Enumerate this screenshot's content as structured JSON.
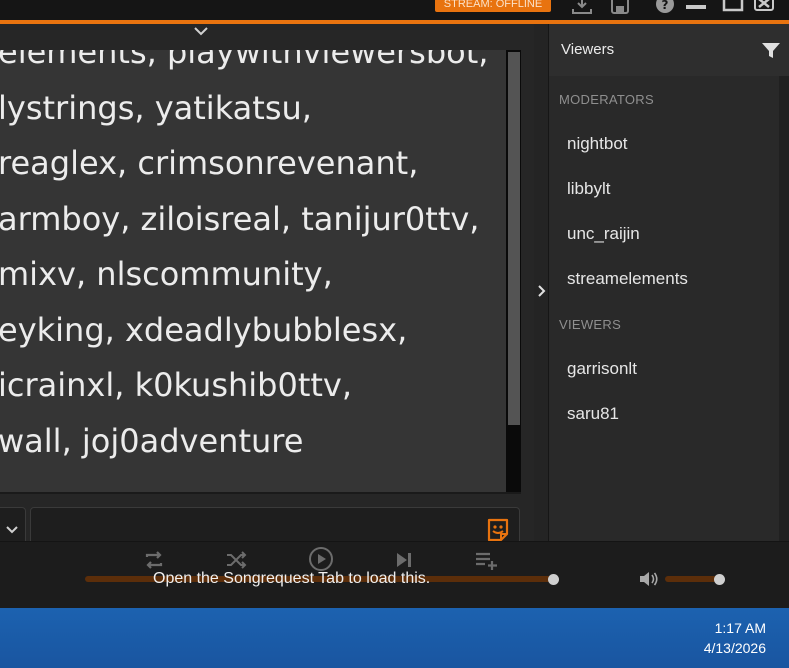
{
  "titlebar": {
    "stream_status": "STREAM: OFFLINE",
    "icons": [
      "download-icon",
      "save-icon",
      "help-icon",
      "minimize-icon",
      "maximize-icon",
      "close-icon"
    ]
  },
  "chat": {
    "lines": [
      "elements, playwithviewersbot,",
      "lystrings, yatikatsu,",
      "reaglex, crimsonrevenant,",
      "armboy, ziloisreal, tanijur0ttv,",
      "mixv, nlscommunity,",
      "eyking, xdeadlybubblesx,",
      "icrainxl, k0kushib0ttv,",
      "wall, joj0adventure"
    ],
    "input_value": "",
    "accent_color": "#e8730f"
  },
  "viewers": {
    "title": "Viewers",
    "moderators_label": "MODERATORS",
    "moderators": [
      "nightbot",
      "libbylt",
      "unc_raijin",
      "streamelements"
    ],
    "viewers_label": "VIEWERS",
    "viewers": [
      "garrisonlt",
      "saru81"
    ]
  },
  "player": {
    "message": "Open the Songrequest Tab to load this.",
    "controls": [
      "repeat-icon",
      "shuffle-icon",
      "play-icon",
      "skip-next-icon",
      "add-to-queue-icon"
    ],
    "progress": 1.0,
    "volume": 0.9
  },
  "taskbar": {
    "time": "1:17 AM",
    "date": "4/13/2026"
  }
}
